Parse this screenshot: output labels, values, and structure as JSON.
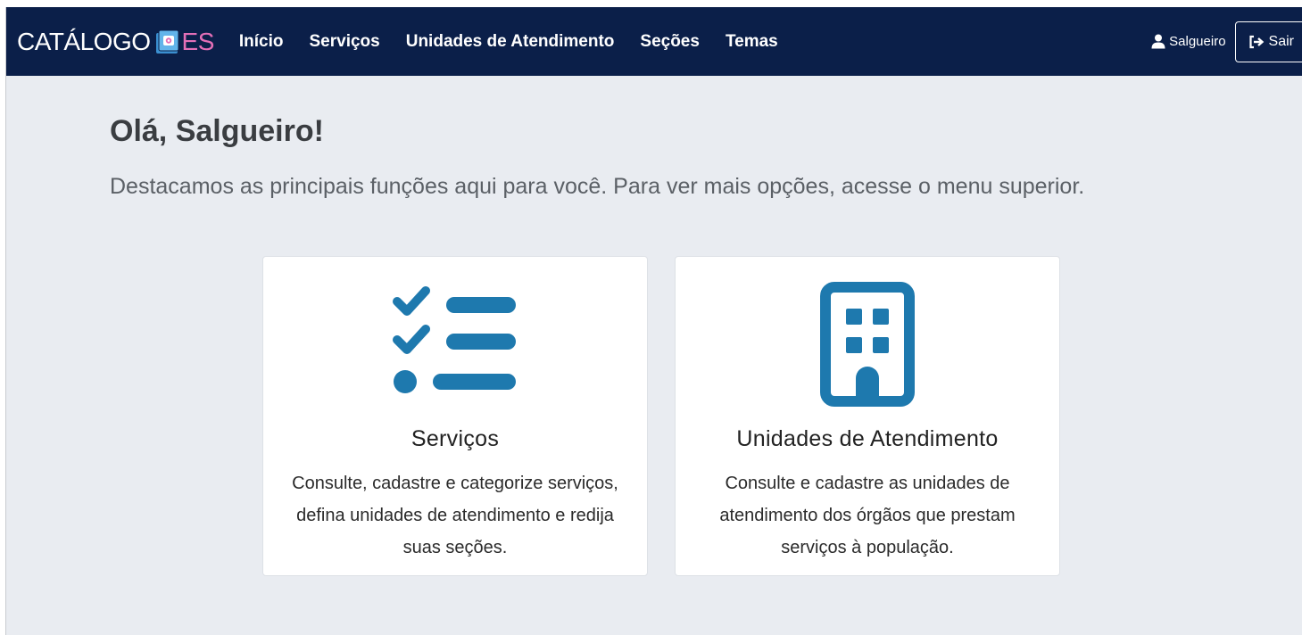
{
  "brand": {
    "title": "CATÁLOGO",
    "suffix": "ES"
  },
  "nav": {
    "items": [
      {
        "label": "Início"
      },
      {
        "label": "Serviços"
      },
      {
        "label": "Unidades de Atendimento"
      },
      {
        "label": "Seções"
      },
      {
        "label": "Temas"
      }
    ],
    "user_name": "Salgueiro",
    "logout_label": "Sair",
    "logout_icon": "sign-out-icon",
    "user_icon": "user-icon"
  },
  "hero": {
    "greeting": "Olá, Salgueiro!",
    "subtitle": "Destacamos as principais funções aqui para você. Para ver mais opções, acesse o menu superior."
  },
  "cards": [
    {
      "icon": "checklist-icon",
      "title": "Serviços",
      "description": "Consulte, cadastre e categorize serviços, defina unidades de atendimento e redija suas seções."
    },
    {
      "icon": "building-icon",
      "title": "Unidades de Atendimento",
      "description": "Consulte e cadastre as unidades de atendimento dos órgãos que prestam serviços à população."
    }
  ],
  "colors": {
    "navbar": "#0b1f49",
    "background": "#e9ecf1",
    "icon_blue": "#1e79ae",
    "brand_pink": "#e36fb7"
  }
}
